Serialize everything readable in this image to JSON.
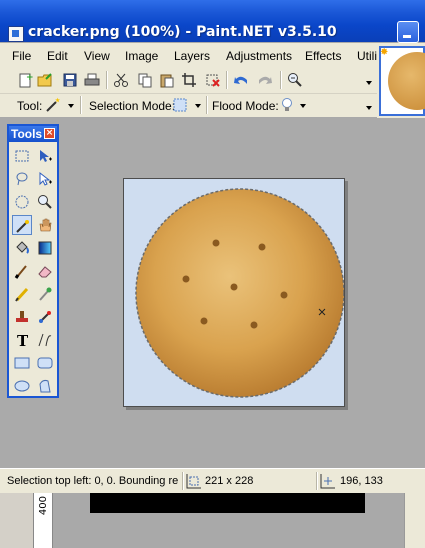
{
  "window": {
    "title": "cracker.png (100%) - Paint.NET v3.5.10"
  },
  "menu": {
    "items": [
      "File",
      "Edit",
      "View",
      "Image",
      "Layers",
      "Adjustments",
      "Effects",
      "Utilit"
    ]
  },
  "toolbar2": {
    "tool_label": "Tool:",
    "selection_mode_label": "Selection Mode:",
    "flood_mode_label": "Flood Mode:"
  },
  "tools_window": {
    "title": "Tools",
    "close": "×"
  },
  "status": {
    "selection_text": "Selection top left: 0, 0. Bounding re",
    "size": "221 x 228",
    "cursor": "196, 133"
  },
  "ruler": {
    "value": "400"
  },
  "colors": {
    "title_bar": "#0a46c9",
    "chrome": "#ece9d8",
    "canvas_bg": "#cfddf0",
    "cracker": "#d9a24e"
  }
}
